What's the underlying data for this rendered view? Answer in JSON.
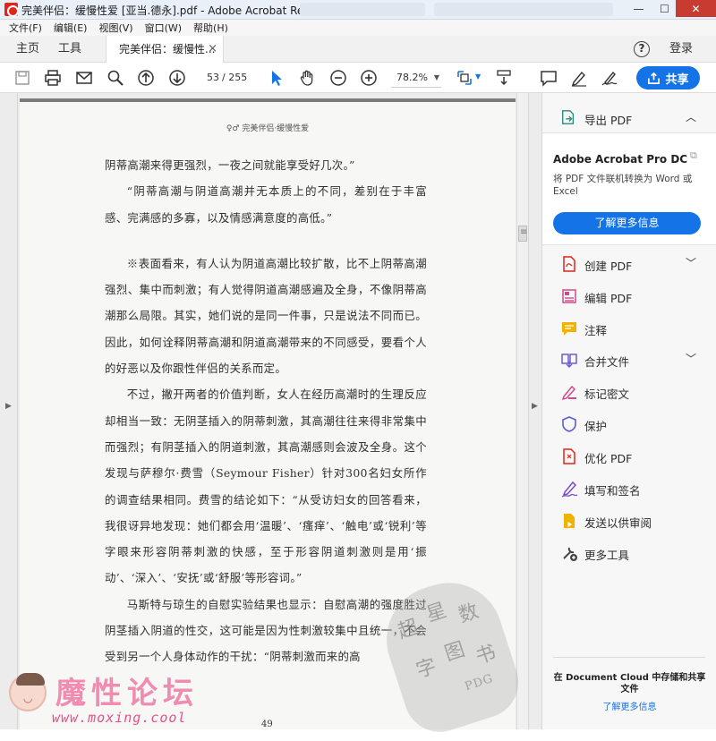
{
  "window": {
    "title": "完美伴侣：缓慢性爱 [亚当.德永].pdf - Adobe Acrobat Reader DC",
    "minimize": "—",
    "maximize": "☐",
    "close": "✕"
  },
  "menu": [
    "文件(F)",
    "编辑(E)",
    "视图(V)",
    "窗口(W)",
    "帮助(H)"
  ],
  "tabs": {
    "home": "主页",
    "tools": "工具",
    "document": "完美伴侣：缓慢性...",
    "close": "×",
    "help": "?",
    "login": "登录"
  },
  "toolbar": {
    "page_current": "53",
    "page_total": "/ 255",
    "zoom": "78.2%",
    "share": "共享",
    "icons": [
      "save-icon",
      "print-icon",
      "email-icon",
      "search-icon",
      "page-up-icon",
      "page-down-icon",
      "select-cursor-icon",
      "hand-icon",
      "zoom-out-icon",
      "zoom-in-icon",
      "fit-page-icon",
      "scroll-mode-icon",
      "comment-icon",
      "highlight-pen-icon",
      "sign-icon",
      "share-icon"
    ]
  },
  "document": {
    "running_head": "♀♂  完美伴侣·缓慢性爱",
    "paragraphs": [
      {
        "indent": false,
        "text": "阴蒂高潮来得更强烈，一夜之间就能享受好几次。”"
      },
      {
        "indent": true,
        "text": "“阴蒂高潮与阴道高潮并无本质上的不同，差别在于丰富感、完满感的多寡，以及情感满意度的高低。”"
      },
      {
        "indent": true,
        "gap_before": true,
        "text": "※表面看来，有人认为阴道高潮比较扩散，比不上阴蒂高潮强烈、集中而刺激；有人觉得阴道高潮感遍及全身，不像阴蒂高潮那么局限。其实，她们说的是同一件事，只是说法不同而已。因此，如何诠释阴蒂高潮和阴道高潮带来的不同感受，要看个人的好恶以及你跟性伴侣的关系而定。"
      },
      {
        "indent": true,
        "text": "不过，撇开两者的价值判断，女人在经历高潮时的生理反应却相当一致：无阴茎插入的阴蒂刺激，其高潮往往来得非常集中而强烈；有阴茎插入的阴道刺激，其高潮感则会波及全身。这个发现与萨穆尔·费雪（Seymour Fisher）针对300名妇女所作的调查结果相同。费雪的结论如下：“从受访妇女的回答看来，我很讶异地发现：她们都会用‘温暖’、‘瘙痒’、‘触电’或‘锐利’等字眼来形容阴蒂刺激的快感，至于形容阴道刺激则是用‘振动’、‘深入’、‘安抚’或‘舒服’等形容词。”"
      },
      {
        "indent": true,
        "text": "马斯特与琼生的自慰实验结果也显示：自慰高潮的强度胜过阴茎插入阴道的性交，这可能是因为性刺激较集中且统一，不会受到另一个人身体动作的干扰：“阴蒂刺激而来的高"
      }
    ],
    "page_number": "49",
    "stamp_chars": [
      "超",
      "星",
      "数",
      "字",
      "图",
      "书"
    ],
    "stamp_pdg": "PDG"
  },
  "watermark": {
    "title": "魔性论坛",
    "url": "www.moxing.cool"
  },
  "panel": {
    "export_pdf": "导出 PDF",
    "promo_title": "Adobe Acrobat Pro DC",
    "promo_desc": "将 PDF 文件联机转换为 Word 或 Excel",
    "promo_button": "了解更多信息",
    "tools": [
      {
        "label": "创建 PDF",
        "icon": "create-pdf-icon",
        "color": "#e1251b",
        "chevron": true
      },
      {
        "label": "编辑 PDF",
        "icon": "edit-pdf-icon",
        "color": "#d34a8c",
        "chevron": false
      },
      {
        "label": "注释",
        "icon": "comment-icon",
        "color": "#f0b400",
        "chevron": false
      },
      {
        "label": "合并文件",
        "icon": "combine-files-icon",
        "color": "#6b5bd3",
        "chevron": true
      },
      {
        "label": "标记密文",
        "icon": "redact-icon",
        "color": "#d34a8c",
        "chevron": false
      },
      {
        "label": "保护",
        "icon": "protect-shield-icon",
        "color": "#5b5bd3",
        "chevron": false
      },
      {
        "label": "优化 PDF",
        "icon": "optimize-pdf-icon",
        "color": "#e1251b",
        "chevron": false
      },
      {
        "label": "填写和签名",
        "icon": "fill-sign-icon",
        "color": "#7a4cc7",
        "chevron": false
      },
      {
        "label": "发送以供审阅",
        "icon": "send-review-icon",
        "color": "#f0b400",
        "chevron": false
      },
      {
        "label": "更多工具",
        "icon": "more-tools-icon",
        "color": "#444444",
        "chevron": false
      }
    ],
    "cloud_text": "在 Document Cloud 中存储和共享文件",
    "cloud_link": "了解更多信息"
  },
  "colors": {
    "accent": "#1473e6",
    "close_button": "#c73b31"
  }
}
